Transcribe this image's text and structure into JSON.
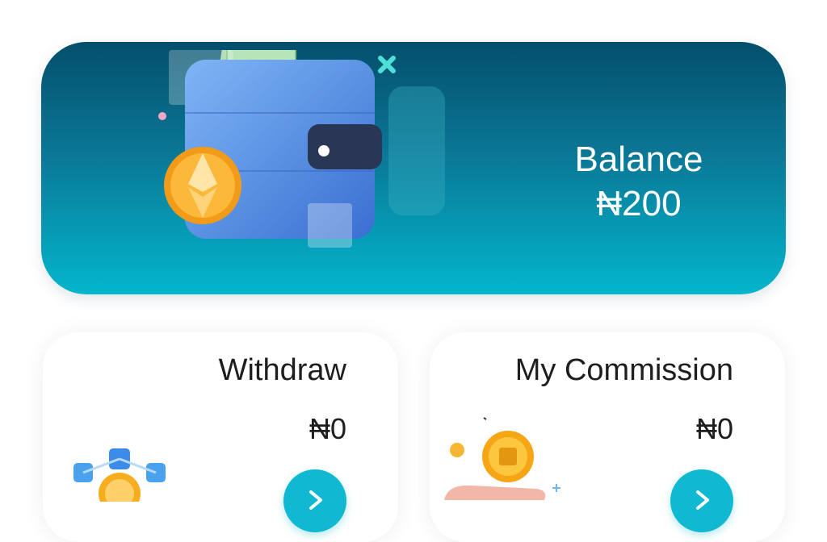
{
  "balance": {
    "label": "Balance",
    "amount": "₦200",
    "icon": "wallet-icon",
    "coin_icon": "ethereum-coin-icon"
  },
  "withdraw": {
    "title": "Withdraw",
    "amount": "₦0",
    "icon": "blockchain-coin-icon",
    "button_icon": "arrow-right-icon"
  },
  "commission": {
    "title": "My Commission",
    "amount": "₦0",
    "icon": "hand-coin-icon",
    "button_icon": "arrow-right-icon"
  },
  "colors": {
    "balance_gradient_top": "#044f6c",
    "balance_gradient_bottom": "#04b6cd",
    "accent": "#10b8d2",
    "text": "#1e1e1e"
  }
}
